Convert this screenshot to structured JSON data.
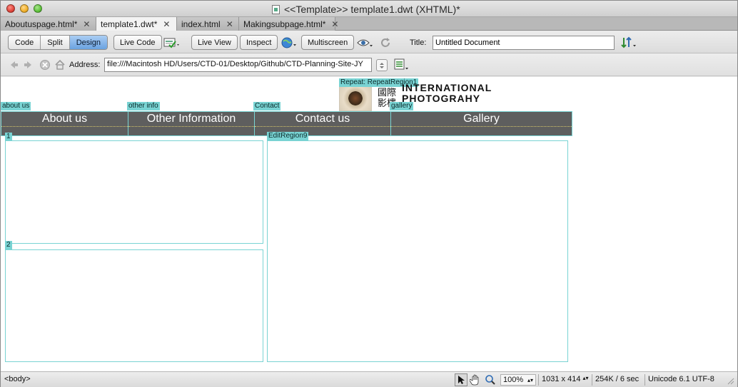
{
  "window": {
    "title": "<<Template>> template1.dwt (XHTML)*"
  },
  "tabs": [
    {
      "label": "Aboutuspage.html*",
      "active": false
    },
    {
      "label": "template1.dwt*",
      "active": true
    },
    {
      "label": "index.html",
      "active": false
    },
    {
      "label": "Makingsubpage.html*",
      "active": false
    }
  ],
  "toolbar": {
    "view_modes": [
      "Code",
      "Split",
      "Design"
    ],
    "active_view": "Design",
    "live_code": "Live Code",
    "live_view": "Live View",
    "inspect": "Inspect",
    "multiscreen": "Multiscreen",
    "title_label": "Title:",
    "title_value": "Untitled Document"
  },
  "address": {
    "label": "Address:",
    "value": "file:///Macintosh HD/Users/CTD-01/Desktop/Github/CTD-Planning-Site-JY"
  },
  "design": {
    "repeat_tag": "Repeat: RepeatRegion1",
    "logo": {
      "cjk_line1": "國際",
      "cjk_line2": "影樓",
      "latin_line1": "INTERNATIONAL",
      "latin_line2": "PHOTOGRAHY"
    },
    "nav_tags": [
      "about us",
      "other info",
      "Contact",
      "gallery"
    ],
    "nav_items": [
      "About us",
      "Other Information",
      "Contact us",
      "Gallery"
    ],
    "region_tags": [
      "1",
      "2",
      "EditRegion9"
    ],
    "accent_color": "#79d3d3",
    "nav_bg_color": "#5e5e5e"
  },
  "statusbar": {
    "tag_selector": "<body>",
    "zoom": "100%",
    "window_size": "1031 x 414",
    "download_stats": "254K / 6 sec",
    "encoding": "Unicode 6.1 UTF-8"
  }
}
